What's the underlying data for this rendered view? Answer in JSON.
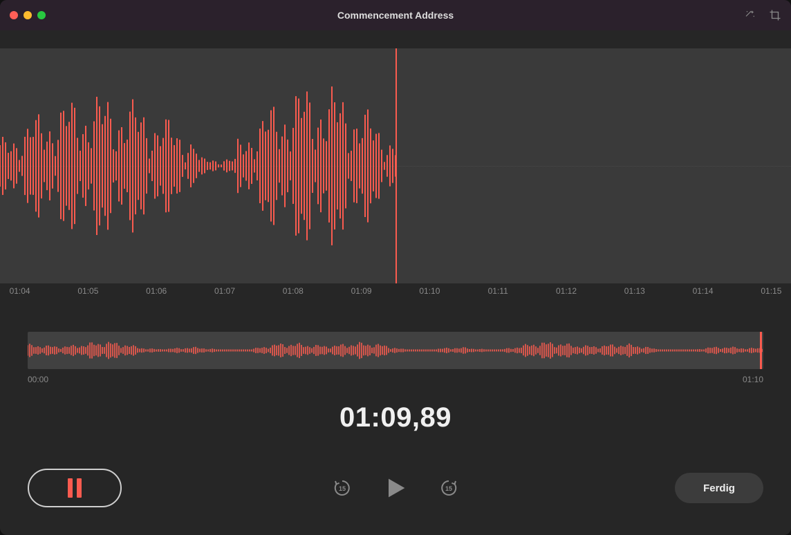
{
  "window": {
    "title": "Commencement Address"
  },
  "ruler": {
    "ticks": [
      "01:04",
      "01:05",
      "01:06",
      "01:07",
      "01:08",
      "01:09",
      "01:10",
      "01:11",
      "01:12",
      "01:13",
      "01:14",
      "01:15"
    ]
  },
  "overview": {
    "start_label": "00:00",
    "end_label": "01:10"
  },
  "elapsed": "01:09,89",
  "skip_seconds": "15",
  "done_label": "Ferdig",
  "colors": {
    "accent": "#fa5b4f"
  },
  "playhead_position_pct": 50,
  "overview_playhead_pct": 99.5
}
